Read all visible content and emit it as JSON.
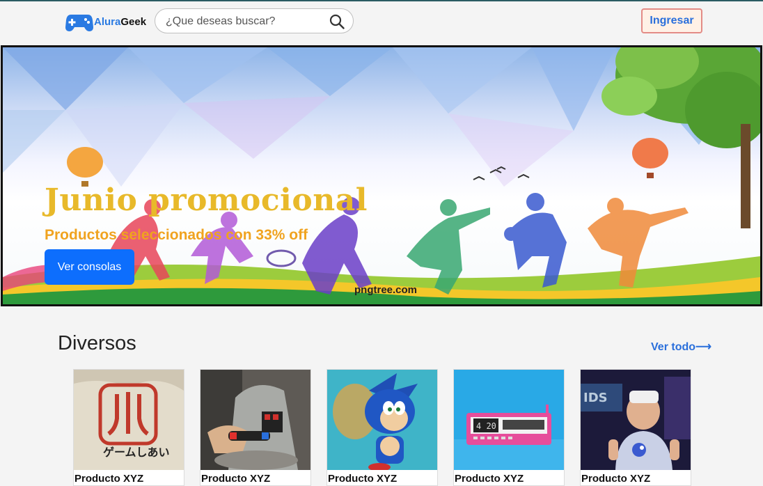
{
  "header": {
    "logo": {
      "part1": "Alura",
      "part2": "Geek",
      "icon": "gamepad-icon"
    },
    "search": {
      "placeholder": "¿Que deseas buscar?",
      "value": "",
      "icon": "search-icon"
    },
    "login_label": "Ingresar"
  },
  "banner": {
    "title": "Junio promocional",
    "subtitle": "Productos seleccionados con 33% off",
    "button_label": "Ver consolas",
    "watermark": "pngtree.com"
  },
  "section": {
    "title": "Diversos",
    "see_all": "Ver todo⟶",
    "products": [
      {
        "name": "Producto XYZ",
        "image": "atari-tshirt"
      },
      {
        "name": "Producto XYZ",
        "image": "kid-with-controller"
      },
      {
        "name": "Producto XYZ",
        "image": "sonic-figure"
      },
      {
        "name": "Producto XYZ",
        "image": "pink-radio-clock"
      },
      {
        "name": "Producto XYZ",
        "image": "kid-vr-headset"
      }
    ]
  },
  "colors": {
    "primary": "#0d6efd",
    "title_gold": "#e8b92a",
    "subtitle_orange": "#f0a31f",
    "link_blue": "#2a6fdb",
    "login_border": "#e38b86",
    "login_bg": "#fff1e6"
  }
}
